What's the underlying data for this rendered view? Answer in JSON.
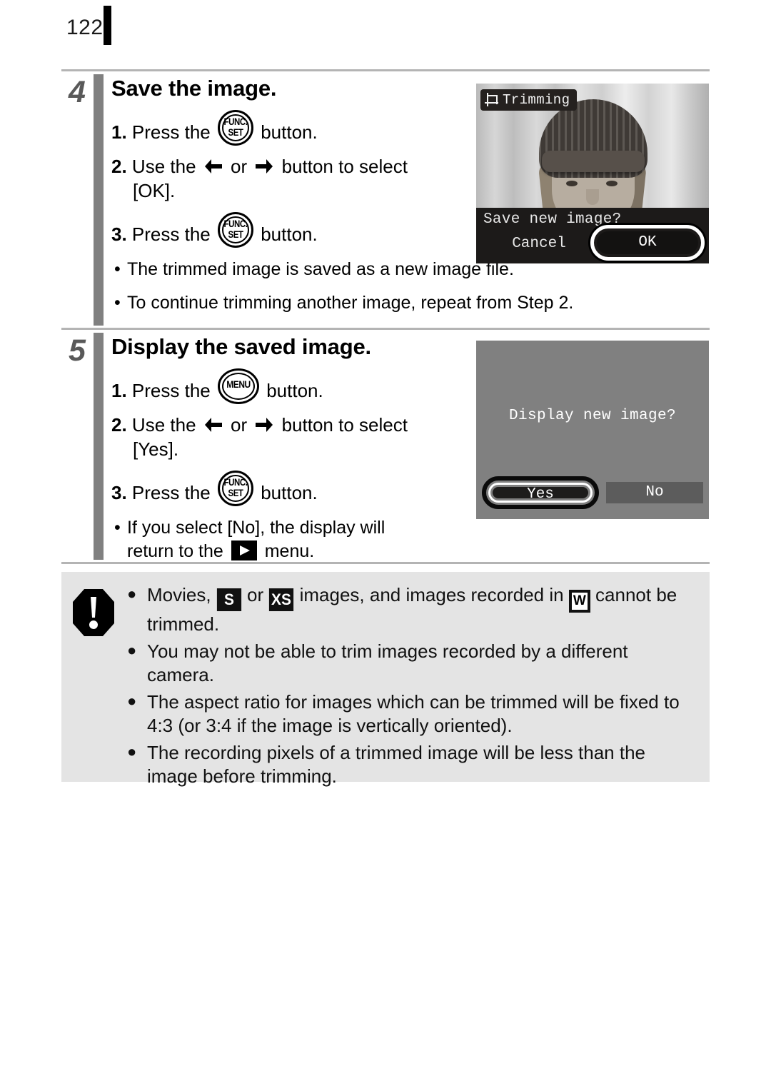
{
  "page": {
    "number": "122"
  },
  "steps": [
    {
      "number": "4",
      "title": "Save the image.",
      "lines": [
        {
          "index": "1.",
          "pre": "Press the",
          "icon": "func-set",
          "post": "button."
        },
        {
          "index": "2.",
          "pre": "Use the",
          "icon": "left-right-arrows",
          "post": "button to select",
          "cont": "[OK]."
        },
        {
          "index": "3.",
          "pre": "Press the",
          "icon": "func-set",
          "post": "button."
        }
      ],
      "notes": [
        "The trimmed image is saved as a new image file.",
        "To continue trimming another image, repeat from Step 2."
      ]
    },
    {
      "number": "5",
      "title": "Display the saved image.",
      "lines": [
        {
          "index": "1.",
          "pre": "Press the",
          "icon": "menu",
          "post": "button."
        },
        {
          "index": "2.",
          "pre": "Use the",
          "icon": "left-right-arrows",
          "post": "button to select",
          "cont": "[Yes]."
        },
        {
          "index": "3.",
          "pre": "Press the",
          "icon": "func-set",
          "post": "button."
        }
      ],
      "notes_playback": {
        "pre": "If you select [No], the display will",
        "mid": "return to the",
        "icon": "playback-menu",
        "post": "menu."
      }
    }
  ],
  "screens": {
    "trimming": {
      "label": "Trimming",
      "label_icon": "crop-icon",
      "prompt": "Save new image?",
      "cancel_label": "Cancel",
      "ok_label": "OK",
      "selected": "OK"
    },
    "display": {
      "prompt": "Display new image?",
      "yes_label": "Yes",
      "no_label": "No",
      "selected": "Yes",
      "background_color": "#808080"
    }
  },
  "warning": {
    "icon": "exclamation-octagon-icon",
    "items": [
      {
        "segments": [
          {
            "text": "Movies, "
          },
          {
            "badge_dark": "S"
          },
          {
            "text": " or "
          },
          {
            "badge_dark": "XS"
          },
          {
            "text": " images, and images recorded in "
          },
          {
            "badge_light": "W"
          },
          {
            "text": " cannot be trimmed."
          }
        ]
      },
      {
        "text": "You may not be able to trim images recorded by a different camera."
      },
      {
        "text": "The aspect ratio for images which can be trimmed will be fixed to 4:3 (or 3:4 if the image is vertically oriented)."
      },
      {
        "text": "The recording pixels of a trimmed image will be less than the image before trimming."
      }
    ]
  },
  "icons": {
    "func_line1": "FUNC.",
    "func_line2": "SET",
    "menu_label": "MENU",
    "bullet": "●",
    "dot": "•"
  },
  "colors": {
    "rule": "#b4b4b4",
    "step_bar": "#808080",
    "step_number": "#595959",
    "warn_bg": "#e4e4e4",
    "lcd_gray": "#808080"
  }
}
